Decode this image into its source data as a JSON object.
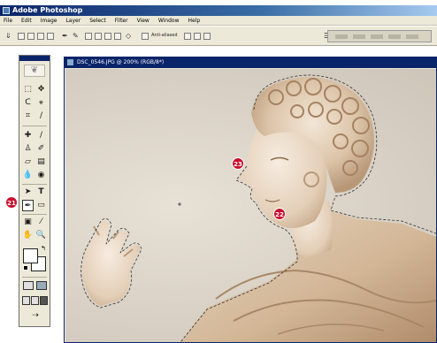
{
  "app": {
    "title": "Adobe Photoshop"
  },
  "menu": {
    "items": [
      "File",
      "Edit",
      "Image",
      "Layer",
      "Select",
      "Filter",
      "View",
      "Window",
      "Help"
    ]
  },
  "options": {
    "antialias_label": "Anti-aliased"
  },
  "document": {
    "title": "DSC_0546.JPG @ 200% (RGB/8*)"
  },
  "callouts": {
    "c21": "21",
    "c22": "22",
    "c23": "23"
  },
  "colors": {
    "title_bar": "#0a246a",
    "chrome": "#ece9d8",
    "callout": "#c8102e",
    "foreground": "#ffffff",
    "background": "#ffffff"
  },
  "tools": {
    "marquee": "marquee-icon",
    "move": "move-icon",
    "lasso": "lasso-icon",
    "magic_wand": "magic-wand-icon",
    "crop": "crop-icon",
    "slice": "slice-icon",
    "healing": "healing-brush-icon",
    "brush": "brush-icon",
    "stamp": "clone-stamp-icon",
    "history_brush": "history-brush-icon",
    "eraser": "eraser-icon",
    "gradient": "gradient-icon",
    "blur": "blur-icon",
    "dodge": "dodge-icon",
    "path_select": "path-selection-icon",
    "type": "type-icon",
    "pen": "pen-icon",
    "shape": "rectangle-shape-icon",
    "notes": "notes-icon",
    "eyedropper": "eyedropper-icon",
    "hand": "hand-icon",
    "zoom": "zoom-icon"
  }
}
